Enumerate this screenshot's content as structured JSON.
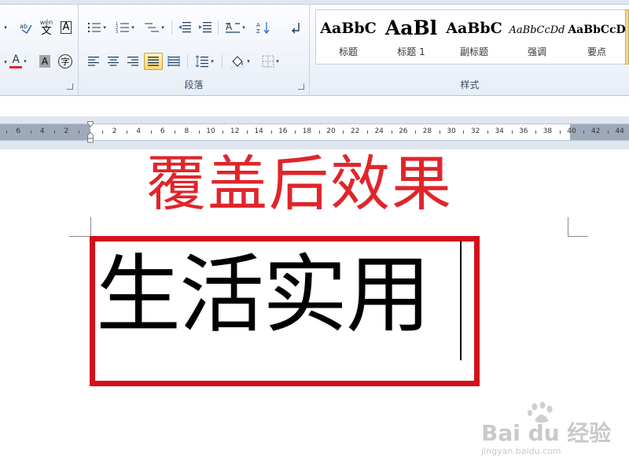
{
  "ribbon": {
    "groups": {
      "paragraph": {
        "label": "段落"
      },
      "styles": {
        "label": "样式"
      }
    },
    "font_tools": {
      "phonetic_glyph": "wén",
      "phonetic_char": "文",
      "border_char": "A",
      "font_color_char": "A",
      "shading_char": "A",
      "enclose_char": "字",
      "font_color": "#e0252a"
    },
    "styles_gallery": [
      {
        "sample": "AaBbC",
        "label": "标题"
      },
      {
        "sample": "AaBl",
        "label": "标题 1"
      },
      {
        "sample": "AaBbC",
        "label": "副标题"
      },
      {
        "sample": "AaBbCcDd",
        "label": "强调"
      },
      {
        "sample": "AaBbCcD",
        "label": "要点"
      }
    ]
  },
  "ruler": {
    "labels": [
      "6",
      "4",
      "2",
      "2",
      "4",
      "6",
      "8",
      "10",
      "12",
      "14",
      "16",
      "18",
      "20",
      "22",
      "24",
      "26",
      "28",
      "30",
      "32",
      "34",
      "36",
      "38",
      "40",
      "42",
      "44"
    ]
  },
  "document": {
    "heading": "覆盖后效果",
    "body_text": "生活实用",
    "heading_color": "#e0252a",
    "box_color": "#d4101a"
  },
  "watermark": {
    "brand": "Bai du 经验",
    "url": "jingyan.baidu.com"
  }
}
